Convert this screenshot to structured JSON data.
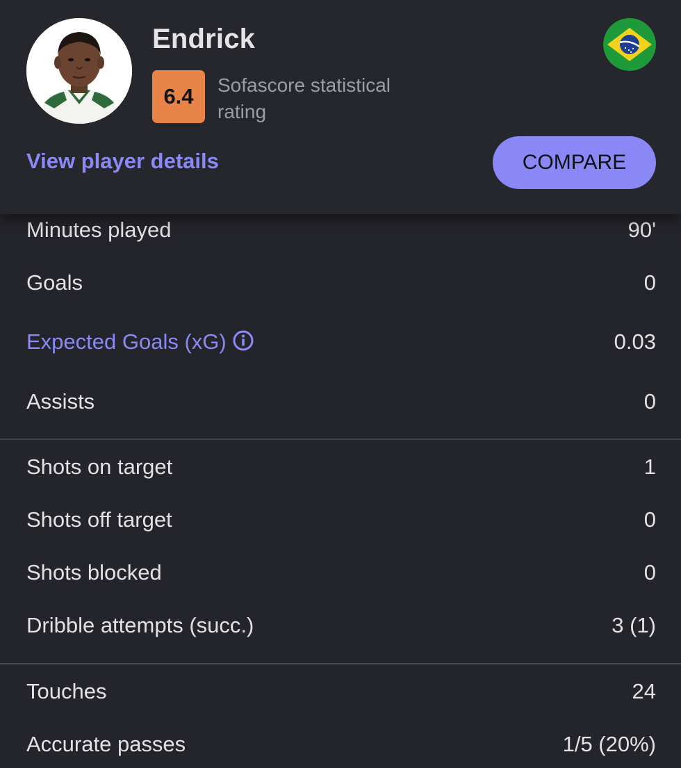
{
  "player": {
    "name": "Endrick",
    "rating": "6.4",
    "rating_label": "Sofascore statistical rating",
    "nationality_icon": "brazil-flag-icon"
  },
  "actions": {
    "details_link": "View player details",
    "compare_button": "COMPARE"
  },
  "colors": {
    "accent": "#8988f6",
    "rating_badge": "#e98449",
    "background": "#24252b"
  },
  "stats_groups": [
    {
      "rows": [
        {
          "label": "Minutes played",
          "value": "90'"
        },
        {
          "label": "Goals",
          "value": "0"
        },
        {
          "label": "Expected Goals (xG)",
          "value": "0.03",
          "info_icon": "info-icon"
        },
        {
          "label": "Assists",
          "value": "0"
        }
      ]
    },
    {
      "rows": [
        {
          "label": "Shots on target",
          "value": "1"
        },
        {
          "label": "Shots off target",
          "value": "0"
        },
        {
          "label": "Shots blocked",
          "value": "0"
        },
        {
          "label": "Dribble attempts (succ.)",
          "value": "3 (1)"
        }
      ]
    },
    {
      "rows": [
        {
          "label": "Touches",
          "value": "24"
        },
        {
          "label": "Accurate passes",
          "value": "1/5 (20%)"
        }
      ]
    }
  ]
}
